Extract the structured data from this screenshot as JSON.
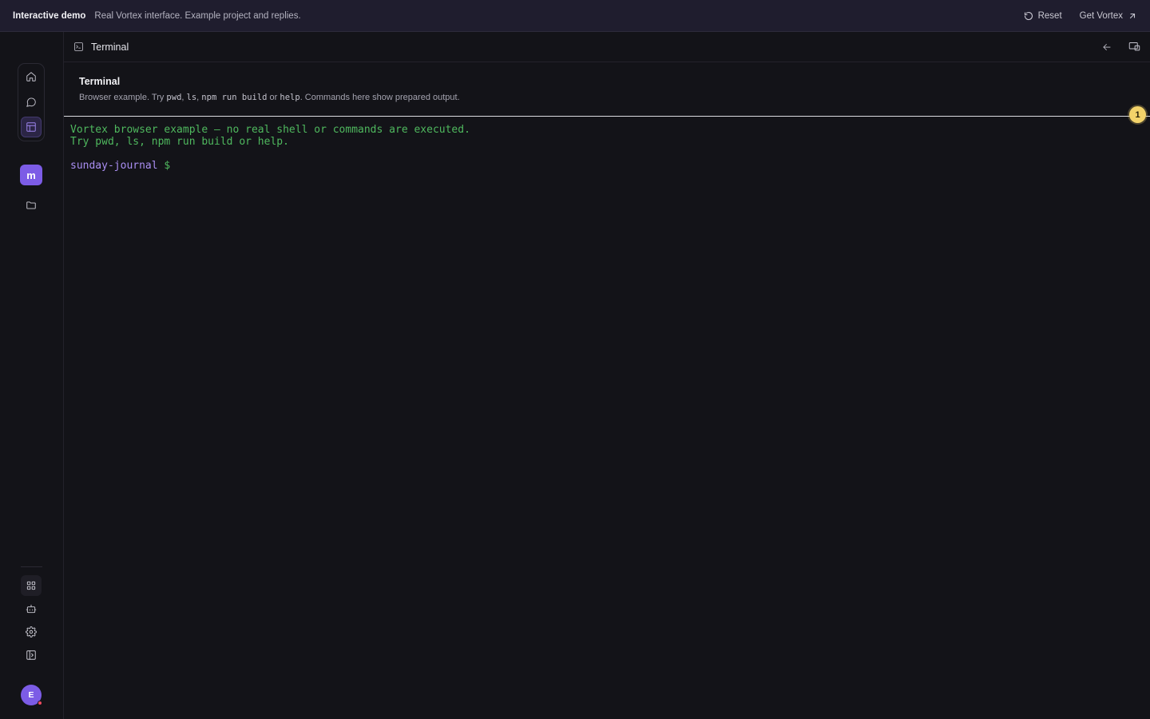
{
  "banner": {
    "title": "Interactive demo",
    "subtitle": "Real Vortex interface. Example project and replies.",
    "reset_label": "Reset",
    "get_label": "Get Vortex"
  },
  "sidebar": {
    "nav": [
      {
        "name": "home",
        "icon": "home-icon",
        "active": false
      },
      {
        "name": "chat",
        "icon": "chat-bubble-icon",
        "active": false
      },
      {
        "name": "layout",
        "icon": "layout-icon",
        "active": true
      }
    ],
    "project_initial": "m",
    "user_initial": "E"
  },
  "panel": {
    "header_title": "Terminal",
    "section_title": "Terminal",
    "desc": {
      "p1": "Browser example. Try ",
      "c1": "pwd",
      "p2": ", ",
      "c2": "ls",
      "p3": ", ",
      "c3": "npm run build",
      "p4": " or ",
      "c4": "help",
      "p5": ". Commands here show prepared output."
    }
  },
  "marker": "1",
  "terminal": {
    "lines": [
      "Vortex browser example — no real shell or commands are executed.",
      "Try pwd, ls, npm run build or help."
    ],
    "prompt_name": "sunday-journal",
    "prompt_sign": "$"
  },
  "colors": {
    "accent": "#7c5ce6",
    "terminal_text": "#4fb85e",
    "prompt": "#a98ef2",
    "marker": "#f3d36a"
  }
}
